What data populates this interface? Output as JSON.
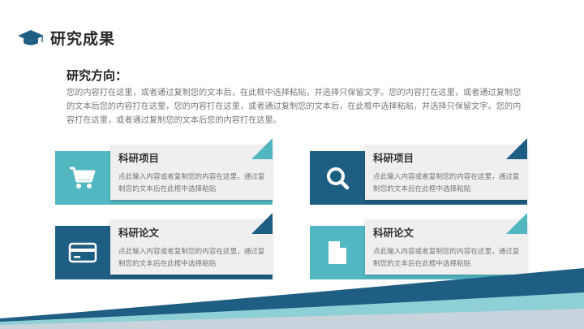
{
  "header": {
    "title": "研究成果",
    "icon": "graduation-cap-icon"
  },
  "section": {
    "heading": "研究方向：",
    "body": "您的内容打在这里，或者通过复制您的文本后，在此框中选择粘贴，并选择只保留文字。您的内容打在这里，或者通过复制您的文本后您的内容打在这里，您的内容打在这里，或者通过复制您的文本后，在此框中选择粘贴，并选择只保留文字。您的内容打在这里，或者通过复制您的文本后您的内容打在这里。"
  },
  "cards": [
    {
      "title": "科研项目",
      "desc": "点此输入内容或者复制您的内容在这里，通过复制您的文本后在此框中选择粘贴",
      "icon": "shopping-cart-icon"
    },
    {
      "title": "科研项目",
      "desc": "点此输入内容或者复制您的内容在这里，通过复制您的文本后在此框中选择粘贴",
      "icon": "search-icon"
    },
    {
      "title": "科研论文",
      "desc": "点此输入内容或者复制您的内容在这里，通过复制您的文本后在此框中选择粘贴",
      "icon": "credit-card-icon"
    },
    {
      "title": "科研论文",
      "desc": "点此输入内容或者复制您的内容在这里，通过复制您的文本后在此框中选择粘贴",
      "icon": "document-icon"
    }
  ],
  "colors": {
    "teal": "#52b7c1",
    "navy": "#1f5e83",
    "panel": "#efefef"
  }
}
